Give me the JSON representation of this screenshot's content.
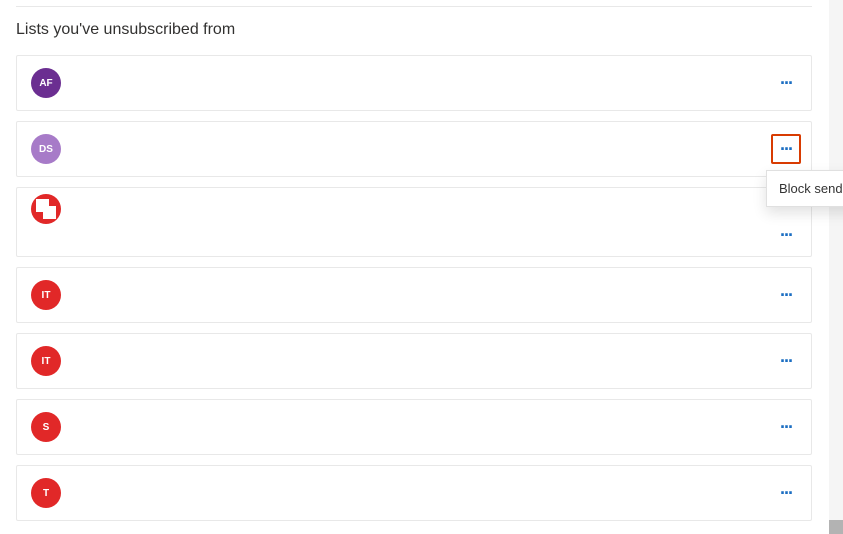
{
  "section": {
    "title": "Lists you've unsubscribed from"
  },
  "senders": [
    {
      "initials": "AF",
      "bg": "#6b2e91",
      "type": "initials",
      "highlight": false,
      "tall": false
    },
    {
      "initials": "DS",
      "bg": "#a77bc8",
      "type": "initials",
      "highlight": true,
      "tall": false
    },
    {
      "initials": "",
      "bg": "#e12828",
      "type": "flip",
      "highlight": false,
      "tall": true
    },
    {
      "initials": "IT",
      "bg": "#e12828",
      "type": "initials",
      "highlight": false,
      "tall": false
    },
    {
      "initials": "IT",
      "bg": "#e12828",
      "type": "initials",
      "highlight": false,
      "tall": false
    },
    {
      "initials": "S",
      "bg": "#e12828",
      "type": "initials",
      "highlight": false,
      "tall": false
    },
    {
      "initials": "T",
      "bg": "#e12828",
      "type": "initials",
      "highlight": false,
      "tall": false
    }
  ],
  "menu": {
    "blockSender": "Block sender"
  }
}
